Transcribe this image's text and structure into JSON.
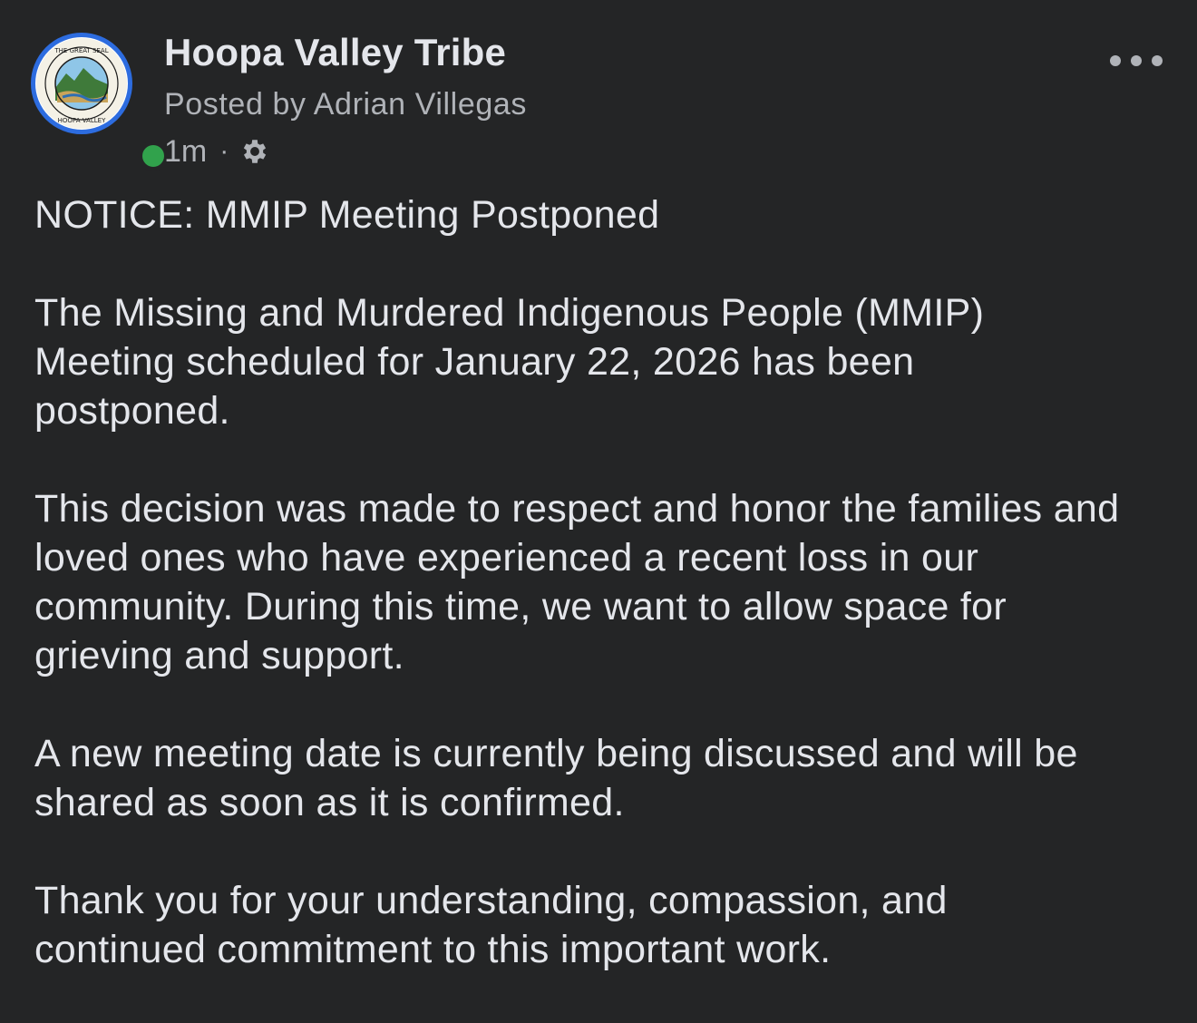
{
  "post": {
    "author": {
      "page_name": "Hoopa Valley Tribe",
      "posted_by": "Posted by Adrian Villegas",
      "avatar_icon": "tribal-seal-logo",
      "online": true
    },
    "meta": {
      "time": "1m",
      "separator": "·",
      "audience_icon": "gear-icon"
    },
    "menu_icon": "more-horizontal-icon",
    "paragraphs": [
      "NOTICE: MMIP Meeting Postponed",
      "The Missing and Murdered Indigenous People (MMIP) Meeting scheduled for January 22, 2026 has been postponed.",
      "This decision was made to respect and honor the families and loved ones who have experienced a recent loss in our community. During this time, we want to allow space for grieving and support.",
      "A new meeting date is currently being discussed and will be shared as soon as it is confirmed.",
      "Thank you for your understanding, compassion, and continued commitment to this important work."
    ],
    "colors": {
      "background": "#242526",
      "primary_text": "#e4e6eb",
      "secondary_text": "#b0b3b8",
      "avatar_ring": "#2d6cdf",
      "online": "#31a24c"
    }
  }
}
